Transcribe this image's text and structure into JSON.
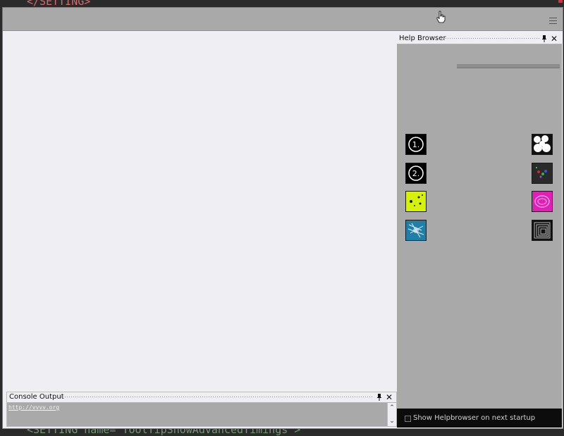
{
  "background_editor": {
    "top_line": "</SETTING>",
    "bottom_line": "<SETTING name=\"ToolTipShowAdvancedTimings\">"
  },
  "toolbar": {
    "menu_icon": "hamburger-icon"
  },
  "help_browser": {
    "title": "Help Browser",
    "pin_icon": "pin-icon",
    "close_icon": "close-icon",
    "left_patches": [
      "tutorial-1",
      "tutorial-2",
      "yellow-dots-example",
      "particle-example"
    ],
    "right_patches": [
      "blobs-example",
      "color-particles-example",
      "pink-sphere-example",
      "tunnel-example"
    ],
    "footer_checkbox_label": "Show Helpbrowser on next startup",
    "footer_checkbox_checked": false,
    "patch1_label": "1.",
    "patch2_label": "2."
  },
  "console": {
    "title": "Console Output",
    "text": "http://vvvv.org"
  },
  "colors": {
    "panel_bg": "#a9a9a9",
    "canvas_bg": "#efeef2",
    "footer_bg": "#0c0c0c"
  }
}
